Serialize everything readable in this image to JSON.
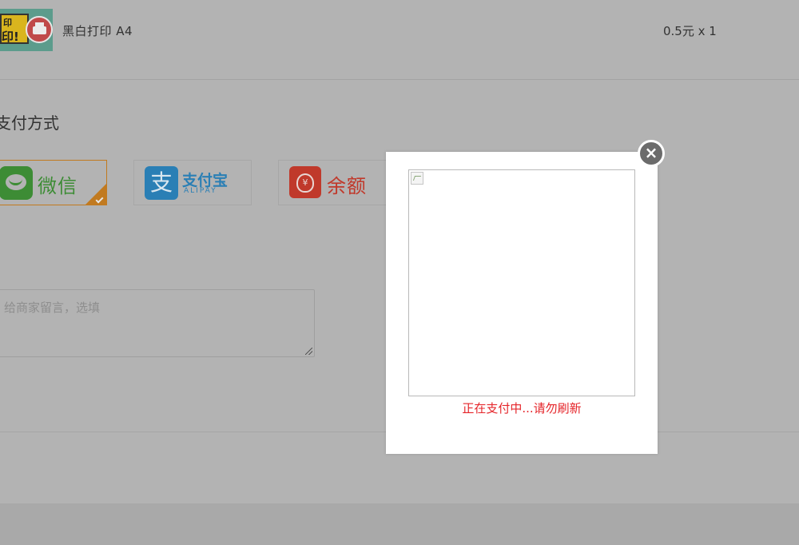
{
  "product": {
    "name": "黑白打印  A4",
    "price": "0.5元 x 1",
    "thumbnail_text_top": "印",
    "thumbnail_text_bottom": "印!"
  },
  "payment": {
    "section_title": "支付方式",
    "options": [
      {
        "label": "微信",
        "icon": "wechat-icon",
        "color": "#3d8c35",
        "selected": true
      },
      {
        "label": "支付宝",
        "sublabel": "ALIPAY",
        "icon": "alipay-icon",
        "color": "#2a7fb5",
        "selected": false
      },
      {
        "label": "余额",
        "icon": "money-bag-icon",
        "color": "#c0392b",
        "selected": false
      }
    ],
    "selected_accent": "#c17a20"
  },
  "note": {
    "placeholder": "给商家留言，选填"
  },
  "modal": {
    "status_text": "正在支付中...请勿刷新",
    "status_color": "#e5252a",
    "close_icon": "close-icon",
    "qr_icon": "broken-image-icon"
  }
}
